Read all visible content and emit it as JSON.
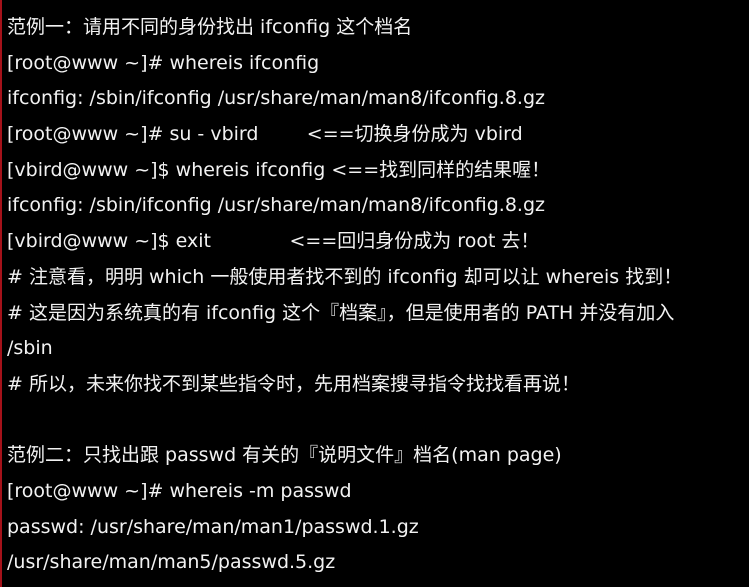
{
  "colors": {
    "background": "#000000",
    "text": "#f2f2f2",
    "left_edge": "#a5121a"
  },
  "terminal": {
    "lines": [
      "范例一：请用不同的身份找出 ifconfig 这个档名",
      "[root@www ~]# whereis ifconfig",
      "ifconfig: /sbin/ifconfig /usr/share/man/man8/ifconfig.8.gz",
      "[root@www ~]# su - vbird        <==切换身份成为 vbird",
      "[vbird@www ~]$ whereis ifconfig <==找到同样的结果喔！",
      "ifconfig: /sbin/ifconfig /usr/share/man/man8/ifconfig.8.gz",
      "[vbird@www ~]$ exit             <==回归身份成为 root 去！",
      "# 注意看，明明 which 一般使用者找不到的 ifconfig 却可以让 whereis 找到！",
      "# 这是因为系统真的有 ifconfig 这个『档案』，但是使用者的 PATH 并没有加入",
      "/sbin",
      "# 所以，未来你找不到某些指令时，先用档案搜寻指令找找看再说！",
      "",
      "范例二：只找出跟 passwd 有关的『说明文件』档名(man page)",
      "[root@www ~]# whereis -m passwd",
      "passwd: /usr/share/man/man1/passwd.1.gz",
      "/usr/share/man/man5/passwd.5.gz"
    ]
  }
}
